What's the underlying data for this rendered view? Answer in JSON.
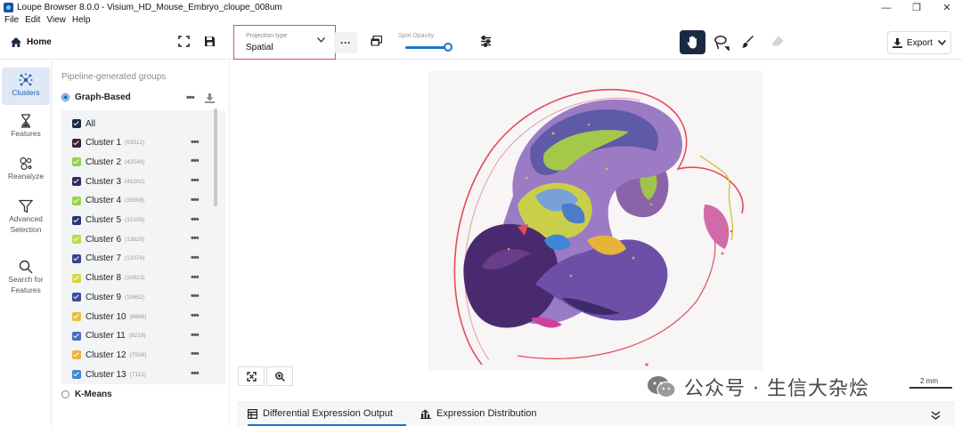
{
  "window": {
    "title": "Loupe Browser 8.0.0 - Visium_HD_Mouse_Embryo_cloupe_008um"
  },
  "menu": [
    "File",
    "Edit",
    "View",
    "Help"
  ],
  "toolbar": {
    "home_label": "Home",
    "projection": {
      "label": "Projection type",
      "value": "Spatial"
    },
    "spot_opacity": {
      "label": "Spot Opacity",
      "level": 0.85
    },
    "export_label": "Export"
  },
  "rail": [
    {
      "label": "Clusters",
      "active": true
    },
    {
      "label": "Features",
      "active": false
    },
    {
      "label": "Reanalyze",
      "active": false
    },
    {
      "label": "Advanced Selection",
      "active": false
    },
    {
      "label": "Search for Features",
      "active": false
    }
  ],
  "groups": {
    "section_title": "Pipeline-generated groups",
    "graph_based": "Graph-Based",
    "kmeans": "K-Means",
    "all_label": "All",
    "clusters": [
      {
        "name": "Cluster 1",
        "count": "(53512)",
        "color": "#3d1f3d"
      },
      {
        "name": "Cluster 2",
        "count": "(42549)",
        "color": "#8ed44a"
      },
      {
        "name": "Cluster 3",
        "count": "(40202)",
        "color": "#2e2a5a"
      },
      {
        "name": "Cluster 4",
        "count": "(35908)",
        "color": "#9bd34a"
      },
      {
        "name": "Cluster 5",
        "count": "(32100)",
        "color": "#2a3470"
      },
      {
        "name": "Cluster 6",
        "count": "(13620)",
        "color": "#b5dd45"
      },
      {
        "name": "Cluster 7",
        "count": "(12074)",
        "color": "#3a3f8a"
      },
      {
        "name": "Cluster 8",
        "count": "(10823)",
        "color": "#d6d63e"
      },
      {
        "name": "Cluster 9",
        "count": "(10652)",
        "color": "#3b4aa0"
      },
      {
        "name": "Cluster 10",
        "count": "(8666)",
        "color": "#e2c43a"
      },
      {
        "name": "Cluster 11",
        "count": "(8219)",
        "color": "#4a6cc4"
      },
      {
        "name": "Cluster 12",
        "count": "(7508)",
        "color": "#e8b43a"
      },
      {
        "name": "Cluster 13",
        "count": "(7112)",
        "color": "#3f86d6"
      }
    ]
  },
  "canvas": {
    "scale_label": "2 mm",
    "watermark": "公众号 · 生信大杂烩"
  },
  "bottom_tabs": [
    {
      "label": "Differential Expression Output",
      "active": true
    },
    {
      "label": "Expression Distribution",
      "active": false
    }
  ]
}
